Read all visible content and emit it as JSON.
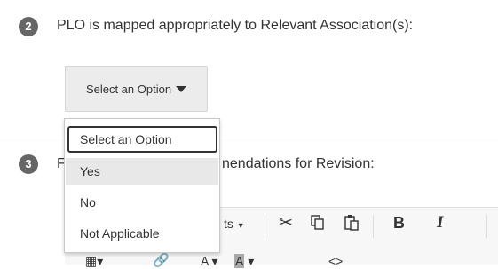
{
  "question2": {
    "number": "2",
    "text": "PLO is mapped appropriately to Relevant Association(s):",
    "select": {
      "label": "Select an Option"
    }
  },
  "question3": {
    "number": "3",
    "text_prefix": "F",
    "text_suffix": "nendations for Revision:"
  },
  "dropdown": {
    "options": [
      "Select an Option",
      "Yes",
      "No",
      "Not Applicable"
    ],
    "selected_index": 0,
    "hovered_index": 1
  },
  "toolbar": {
    "formats_partial": "ts",
    "bold_label": "B",
    "italic_label": "I",
    "font_color_label": "A",
    "bg_color_label": "A",
    "source_label": "<>"
  }
}
